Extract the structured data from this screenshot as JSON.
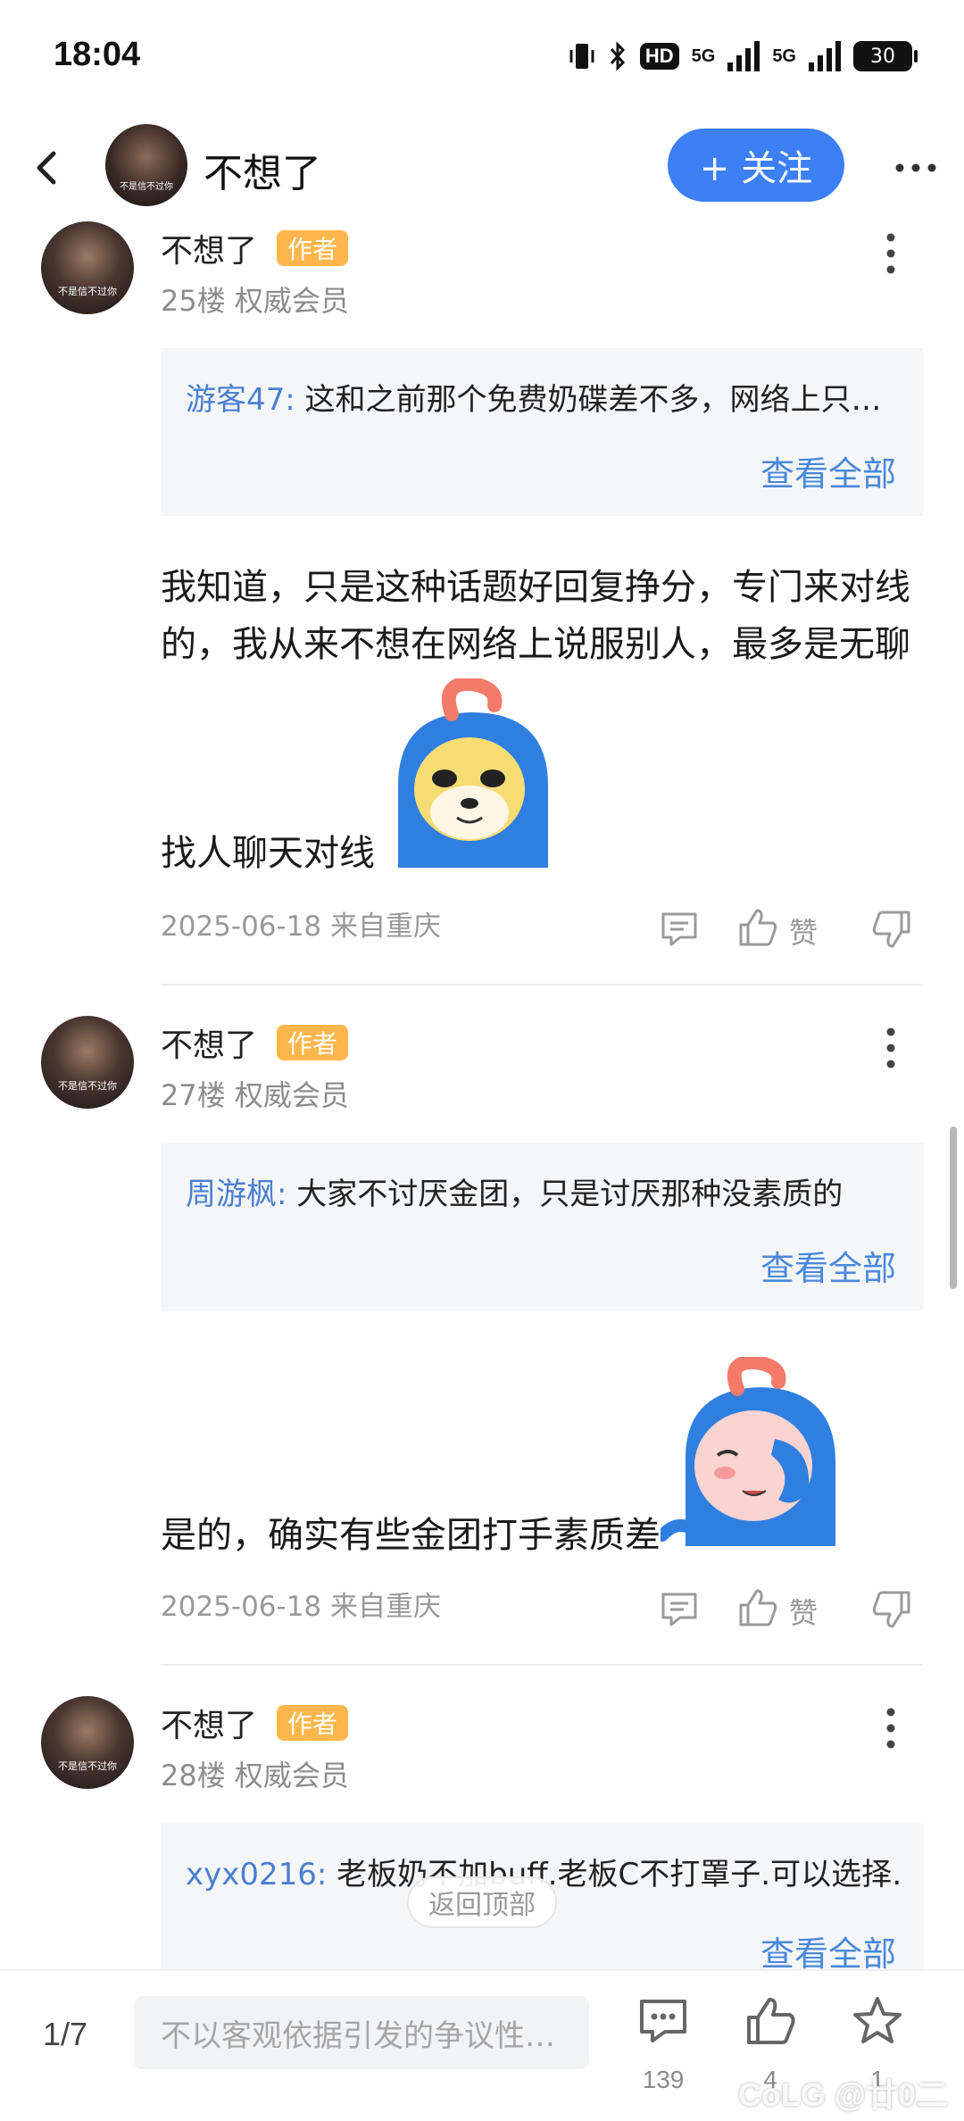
{
  "status_bar": {
    "time": "18:04",
    "hd_label": "HD",
    "network_1": "5G",
    "network_2": "5G",
    "battery": "30"
  },
  "header": {
    "name": "不想了",
    "follow_label": "+ 关注",
    "avatar_caption": "不是信不过你"
  },
  "posts": [
    {
      "name": "不想了",
      "badge": "作者",
      "meta": "25楼 权威会员",
      "avatar_caption": "不是信不过你",
      "quote_user": "游客47:",
      "quote_text": " 这和之前那个免费奶碟差不多，网络上只…",
      "quote_more": "查看全部",
      "body_line1": "我知道，只是这种话题好回复挣分，专门来对线",
      "body_line2": "的，我从来不想在网络上说服别人，最多是无聊",
      "body_line3": "找人聊天对线",
      "date": "2025-06-18 来自重庆",
      "like_label": "赞"
    },
    {
      "name": "不想了",
      "badge": "作者",
      "meta": "27楼 权威会员",
      "avatar_caption": "不是信不过你",
      "quote_user": "周游枫:",
      "quote_text": " 大家不讨厌金团，只是讨厌那种没素质的",
      "quote_more": "查看全部",
      "body_line1": "是的，确实有些金团打手素质差",
      "date": "2025-06-18 来自重庆",
      "like_label": "赞"
    },
    {
      "name": "不想了",
      "badge": "作者",
      "meta": "28楼 权威会员",
      "avatar_caption": "不是信不过你",
      "quote_user": "xyx0216:",
      "quote_text": " 老板奶不加buff.老板C不打罩子.可以选择…",
      "quote_more": "查看全部"
    }
  ],
  "back_to_top": "返回顶部",
  "bottom_bar": {
    "page": "1/7",
    "input_placeholder": "不以客观依据引发的争议性…",
    "comments_count": "139",
    "likes_count": "4",
    "favorites_count": "1",
    "watermark": "CoLG @廿0二"
  },
  "colors": {
    "accent_blue": "#3d7ff4",
    "link_blue": "#4a89dc",
    "badge_orange": "#ffb74d"
  },
  "icons": [
    "back-arrow-icon",
    "more-icon",
    "comment-icon",
    "thumb-up-icon",
    "thumb-down-icon",
    "star-icon"
  ]
}
